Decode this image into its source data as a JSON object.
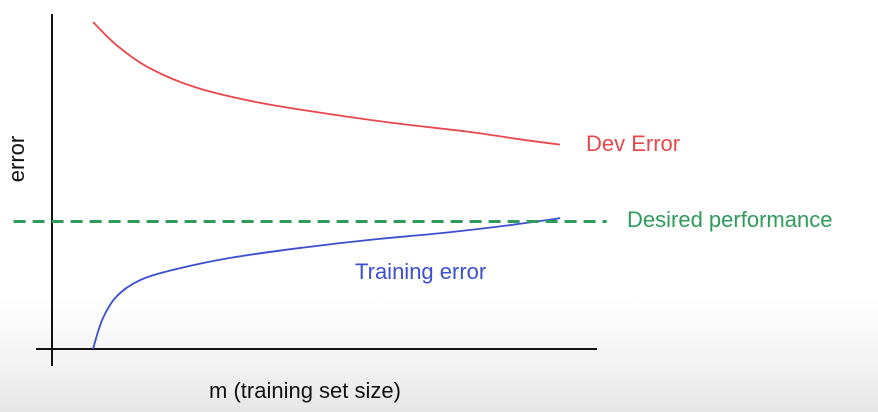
{
  "chart_data": {
    "type": "line",
    "xlabel": "m (training set size)",
    "ylabel": "error",
    "ticks_shown": false,
    "grid": false,
    "series": [
      {
        "name": "Dev Error",
        "color": "#e8474c",
        "style": "solid",
        "points": [
          [
            0.0,
            1.0
          ],
          [
            0.05,
            0.93
          ],
          [
            0.12,
            0.86
          ],
          [
            0.22,
            0.8
          ],
          [
            0.35,
            0.755
          ],
          [
            0.5,
            0.72
          ],
          [
            0.65,
            0.69
          ],
          [
            0.8,
            0.665
          ],
          [
            0.92,
            0.64
          ],
          [
            1.0,
            0.625
          ]
        ]
      },
      {
        "name": "Training error",
        "color": "#3b4fcf",
        "style": "solid",
        "points": [
          [
            0.0,
            0.0
          ],
          [
            0.02,
            0.09
          ],
          [
            0.05,
            0.16
          ],
          [
            0.1,
            0.21
          ],
          [
            0.18,
            0.245
          ],
          [
            0.3,
            0.28
          ],
          [
            0.45,
            0.31
          ],
          [
            0.6,
            0.335
          ],
          [
            0.75,
            0.355
          ],
          [
            0.9,
            0.38
          ],
          [
            1.0,
            0.4
          ]
        ]
      },
      {
        "name": "Desired performance",
        "color": "#2e9b5c",
        "style": "dashed",
        "points": [
          [
            -0.17,
            0.39
          ],
          [
            1.1,
            0.39
          ]
        ]
      }
    ],
    "xlim": [
      -0.17,
      1.1
    ],
    "ylim": [
      -0.02,
      1.06
    ],
    "axis_color": "#111111"
  }
}
